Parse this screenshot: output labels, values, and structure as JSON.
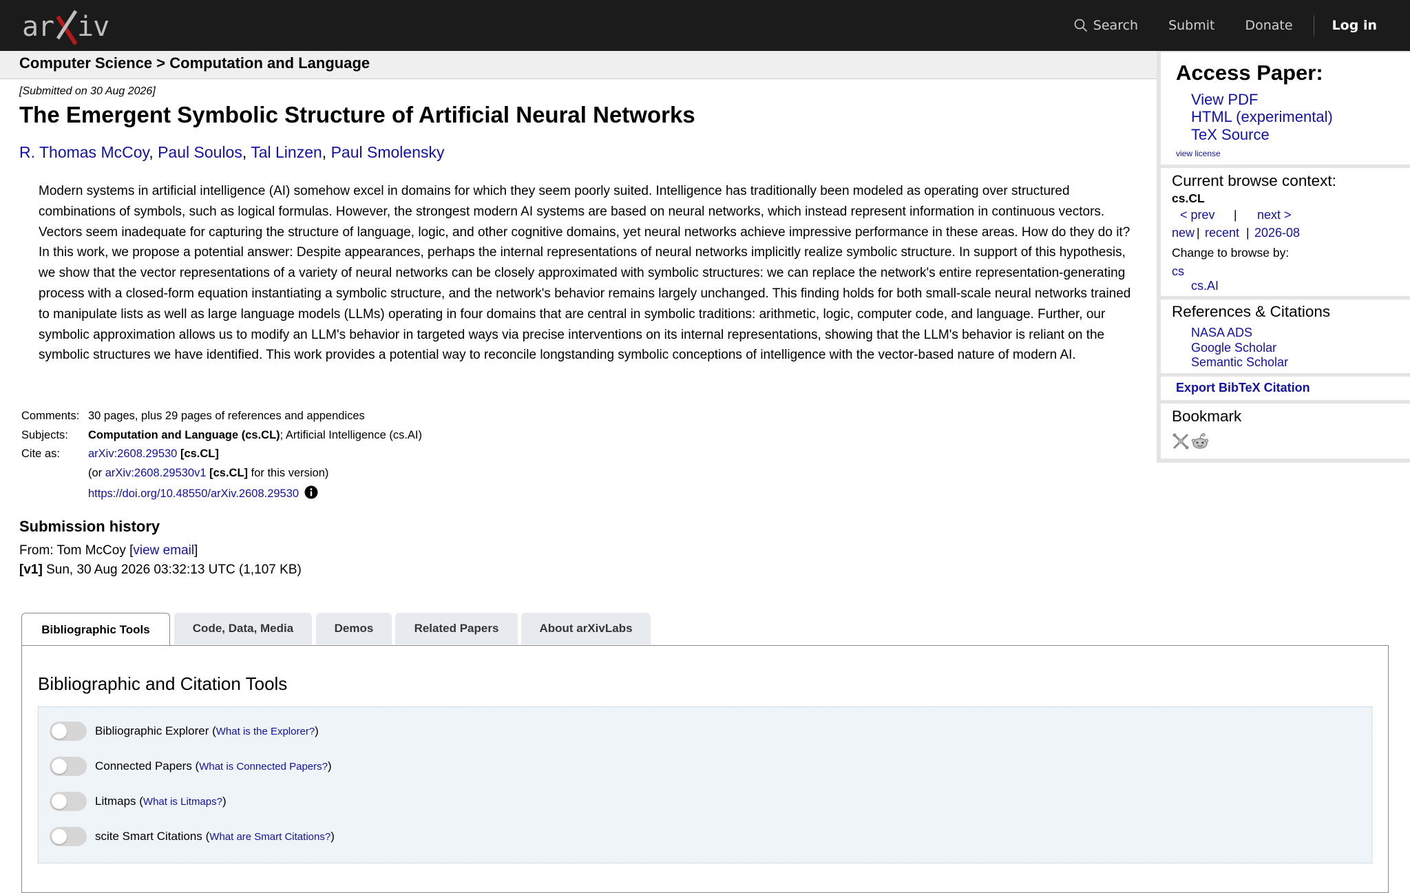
{
  "header": {
    "nav": {
      "search": "Search",
      "submit": "Submit",
      "donate": "Donate",
      "login": "Log in"
    }
  },
  "breadcrumb": "Computer Science > Computation and Language",
  "paper": {
    "submitted": "[Submitted on 30 Aug 2026]",
    "title": "The Emergent Symbolic Structure of Artificial Neural Networks",
    "authors": [
      "R. Thomas McCoy",
      "Paul Soulos",
      "Tal Linzen",
      "Paul Smolensky"
    ],
    "author_separator": ",",
    "abstract": "Modern systems in artificial intelligence (AI) somehow excel in domains for which they seem poorly suited. Intelligence has traditionally been modeled as operating over structured combinations of symbols, such as logical formulas. However, the strongest modern AI systems are based on neural networks, which instead represent information in continuous vectors. Vectors seem inadequate for capturing the structure of language, logic, and other cognitive domains, yet neural networks achieve impressive performance in these areas. How do they do it? In this work, we propose a potential answer: Despite appearances, perhaps the internal representations of neural networks implicitly realize symbolic structure. In support of this hypothesis, we show that the vector representations of a variety of neural networks can be closely approximated with symbolic structures: we can replace the network's entire representation-generating process with a closed-form equation instantiating a symbolic structure, and the network's behavior remains largely unchanged. This finding holds for both small-scale neural networks trained to manipulate lists as well as large language models (LLMs) operating in four domains that are central in symbolic traditions: arithmetic, logic, computer code, and language. Further, our symbolic approximation allows us to modify an LLM's behavior in targeted ways via precise interventions on its internal representations, showing that the LLM's behavior is reliant on the symbolic structures we have identified. This work provides a potential way to reconcile longstanding symbolic conceptions of intelligence with the vector-based nature of modern AI."
  },
  "meta": {
    "comments_label": "Comments:",
    "comments_value": "30 pages, plus 29 pages of references and appendices",
    "subjects_label": "Subjects:",
    "subjects_primary": "Computation and Language (cs.CL)",
    "subjects_rest": "; Artificial Intelligence (cs.AI)",
    "cite_label": "Cite as:",
    "cite_id": "arXiv:2608.29530",
    "cite_tag": "[cs.CL]",
    "cite_or_prefix": "(or ",
    "cite_version_id": "arXiv:2608.29530v1",
    "cite_version_tag": "[cs.CL]",
    "cite_version_suffix": " for this version)",
    "doi": "https://doi.org/10.48550/arXiv.2608.29530"
  },
  "history": {
    "title": "Submission history",
    "from_prefix": "From: Tom McCoy [",
    "from_link": "view email",
    "from_suffix": "]",
    "v1_tag": "[v1]",
    "v1_text": " Sun, 30 Aug 2026 03:32:13 UTC (1,107 KB)"
  },
  "tabs": [
    {
      "label": "Bibliographic Tools",
      "active": true
    },
    {
      "label": "Code, Data, Media"
    },
    {
      "label": "Demos"
    },
    {
      "label": "Related Papers"
    },
    {
      "label": "About arXivLabs"
    }
  ],
  "panel": {
    "title": "Bibliographic and Citation Tools",
    "tools": [
      {
        "name": "Bibliographic Explorer",
        "help": "What is the Explorer?"
      },
      {
        "name": "Connected Papers",
        "help": "What is Connected Papers?"
      },
      {
        "name": "Litmaps",
        "help": "What is Litmaps?"
      },
      {
        "name": "scite Smart Citations",
        "help": "What are Smart Citations?"
      }
    ]
  },
  "sidebar": {
    "access_title": "Access Paper:",
    "view_pdf": "View PDF",
    "html": "HTML (experimental)",
    "tex": "TeX Source",
    "view_license": "view license",
    "context_title": "Current browse context:",
    "context_value": "cs.CL",
    "prev": "< prev",
    "pipe": "|",
    "next": "next >",
    "new": "new",
    "recent": "recent",
    "month": "2026-08",
    "change_to": "Change to browse by:",
    "cs": "cs",
    "cs_ai": "cs.AI",
    "refs_title": "References & Citations",
    "nasa": "NASA ADS",
    "google": "Google Scholar",
    "semantic": "Semantic Scholar",
    "bibtex": "Export BibTeX Citation",
    "bookmark_title": "Bookmark"
  },
  "colors": {
    "header_bg": "#1b1b1b",
    "link": "#1212a8",
    "logo_x": "#b31b1b"
  }
}
